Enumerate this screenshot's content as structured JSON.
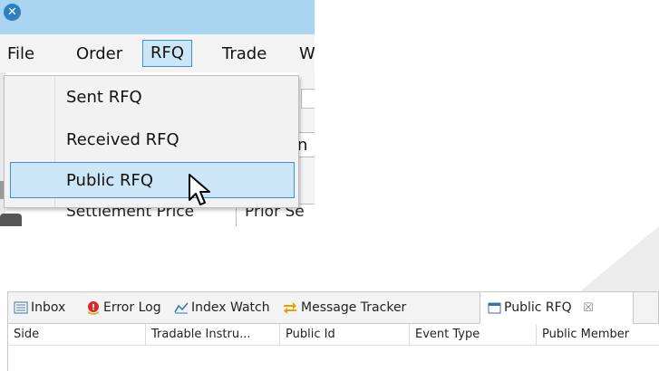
{
  "menubar": {
    "items": [
      "File",
      "Order",
      "RFQ",
      "Trade",
      "W"
    ]
  },
  "rfq_menu": {
    "items": [
      "Sent RFQ",
      "Received RFQ",
      "Public RFQ"
    ]
  },
  "background_fragments": {
    "row_text": "Settlement Price",
    "row_text2": "Prior Se",
    "frag_n": "n"
  },
  "tabs": [
    {
      "label": "Inbox",
      "icon": "inbox-icon"
    },
    {
      "label": "Error Log",
      "icon": "error-log-icon"
    },
    {
      "label": "Index Watch",
      "icon": "index-watch-icon"
    },
    {
      "label": "Message Tracker",
      "icon": "message-tracker-icon"
    },
    {
      "label": "Public RFQ",
      "icon": "window-icon",
      "close": "☒"
    }
  ],
  "table": {
    "columns": [
      "Side",
      "Tradable Instru...",
      "Public Id",
      "Event Type",
      "Public Member"
    ]
  },
  "colors": {
    "titlebar": "#a9d5f1",
    "highlight": "#cce6f8",
    "highlight_border": "#3f8fd6"
  }
}
